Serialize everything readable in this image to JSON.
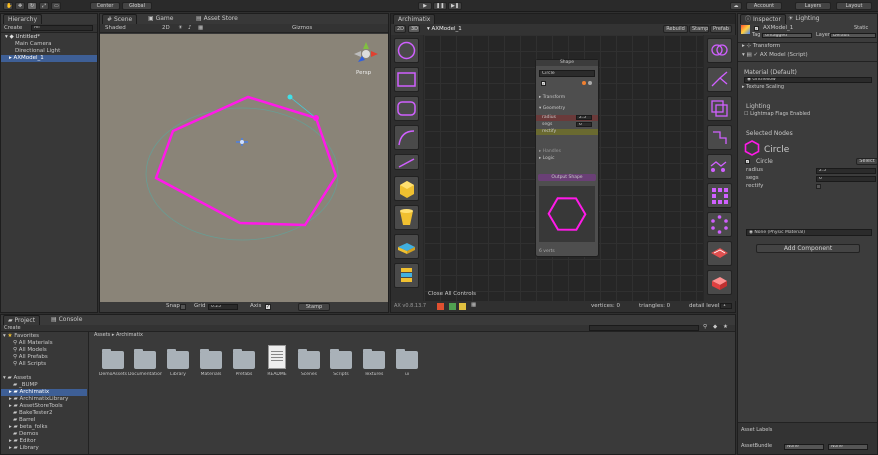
{
  "toolbar": {
    "pivot": "Center",
    "space": "Global",
    "play": "▶",
    "pause": "❚❚",
    "step": "▶❚",
    "account": "Account",
    "layers": "Layers",
    "layout": "Layout"
  },
  "hierarchy": {
    "tab": "Hierarchy",
    "create": "Create",
    "search": "All",
    "scene": "Untitled*",
    "items": [
      "Main Camera",
      "Directional Light",
      "AXModel_1"
    ]
  },
  "scene": {
    "tab_scene": "Scene",
    "tab_game": "Game",
    "tab_store": "Asset Store",
    "shading": "Shaded",
    "mode2d": "2D",
    "gizmos": "Gizmos",
    "persp": "Persp",
    "snap_label": "Snap",
    "grid_label": "Grid",
    "grid_value": "0.25",
    "axis_label": "Axis",
    "stamp": "Stamp"
  },
  "archimatix": {
    "tab": "Archimatix",
    "btn2d": "2D",
    "btn3d": "3D",
    "model": "AXModel_1",
    "rebuild": "Rebuild",
    "stamp": "Stamp",
    "prefab": "Prefab",
    "close_all": "Close All Controls",
    "version": "AX v0.8.13.7",
    "vertices": "vertices: 0",
    "triangles": "triangles: 0",
    "detail_label": "detail level:",
    "detail_value": "1"
  },
  "node": {
    "title": "Shape",
    "name": "Circle",
    "transform": "Transform",
    "geometry": "Geometry",
    "radius_label": "radius",
    "radius_value": "2.5",
    "segs_label": "segs",
    "segs_value": "6",
    "rectify_label": "rectify",
    "handles": "Handles",
    "logic": "Logic",
    "output": "Output Shape",
    "footer": "6 verts"
  },
  "inspector": {
    "tab": "Inspector",
    "tab2": "Lighting",
    "object_name": "AXModel_1",
    "static": "Static",
    "tag_label": "Tag",
    "tag_value": "Untagged",
    "layer_label": "Layer",
    "layer_value": "Default",
    "transform": "Transform",
    "script": "AX Model (Script)",
    "material_label": "Material (Default)",
    "material_value": "GridYellow",
    "texture": "Texture Scaling",
    "lighting": "Lighting",
    "lightmap": "Lightmap Flags Enabled",
    "selected_nodes": "Selected Nodes",
    "circle_title": "Circle",
    "circle_check": "Circle",
    "select_btn": "Select",
    "radius_label": "radius",
    "radius_value": "2.5",
    "segs_label": "segs",
    "segs_value": "6",
    "rectify_label": "rectify",
    "physic": "None (Physic Material)",
    "add_component": "Add Component",
    "asset_labels": "Asset Labels",
    "asset_bundle": "AssetBundle",
    "bundle_value": "None",
    "bundle_value2": "None"
  },
  "project": {
    "tab": "Project",
    "tab2": "Console",
    "create": "Create",
    "favorites": "Favorites",
    "fav_items": [
      "All Materials",
      "All Models",
      "All Prefabs",
      "All Scripts"
    ],
    "assets": "Assets",
    "tree": [
      "_BUMP",
      "Archimatix",
      "ArchimatixLibrary",
      "AssetStoreTools",
      "BakeTester2",
      "Barrel",
      "beta_folks",
      "Demos",
      "Editor",
      "Library"
    ],
    "breadcrumb": "Assets",
    "breadcrumb2": "Archimatix",
    "folders": [
      "DemoAssets",
      "Documentation",
      "Library",
      "Materials",
      "Prefabs",
      "README",
      "Scenes",
      "Scripts",
      "Textures",
      "ui"
    ]
  },
  "colors": {
    "accent": "#ff33dd",
    "node_magenta": "#ff1ae8",
    "selection": "#3e5f96"
  }
}
